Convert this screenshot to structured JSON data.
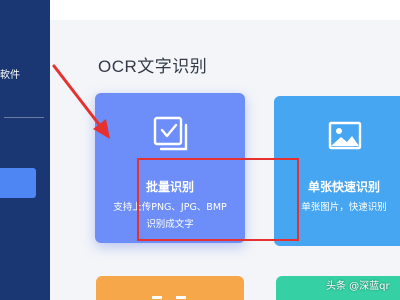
{
  "sidebar": {
    "partial_label": "軟件"
  },
  "main": {
    "title": "OCR文字识别"
  },
  "cards": {
    "batch": {
      "title": "批量识别",
      "desc_line1": "支持上传PNG、JPG、BMP",
      "desc_line2": "识别成文字",
      "icon": "select-image-icon"
    },
    "single": {
      "title": "单张快速识别",
      "desc": "单张图片，快速识别",
      "icon": "image-icon"
    }
  },
  "annotation": {
    "color": "#e5312f"
  },
  "watermark": "头条 @深蓝qr",
  "colors": {
    "sidebar": "#1b3773",
    "batch_card": "#6d8ef8",
    "single_card": "#46a6f2",
    "orange_card": "#f6a74a",
    "green_card": "#36d0a5"
  }
}
